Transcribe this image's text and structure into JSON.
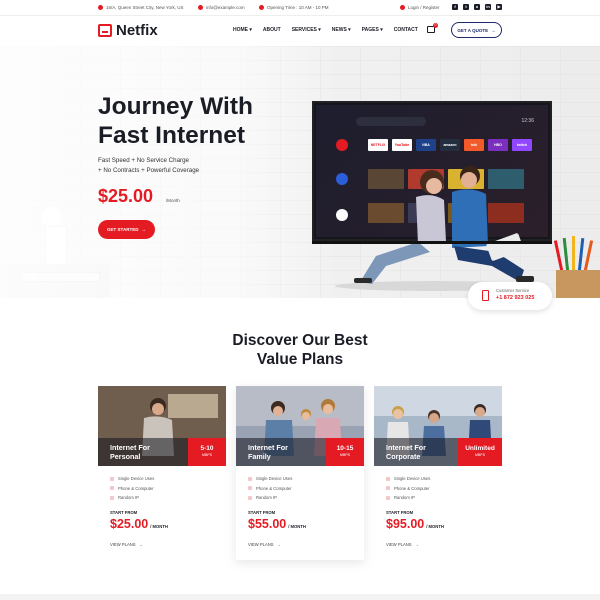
{
  "topbar": {
    "address": "16/A, Queen Street City, New York, US",
    "email": "info@example.com",
    "hours": "Opening Time : 10 AM - 10 PM",
    "login": "Login / Register"
  },
  "nav": {
    "logo": "Netfix",
    "menu": [
      "HOME",
      "ABOUT",
      "SERVICES",
      "NEWS",
      "PAGES",
      "CONTACT"
    ],
    "cart_count": "0",
    "quote": "GET A QUOTE"
  },
  "hero": {
    "title_line1": "Journey With",
    "title_line2": "Fast Internet",
    "sub_line1": "Fast Speed + No Service Charge",
    "sub_line2": "+ No Contracts + Powerful Coverage",
    "price": "$25.00",
    "unit": "/Month",
    "cta": "GET STARTED",
    "tv_time": "12:36",
    "tv_apps": [
      "NETFLIX",
      "YouTube",
      "NBA",
      "amazon",
      "tubi",
      "HBO",
      "twitch"
    ]
  },
  "customer_service": {
    "label": "Customer Service",
    "phone": "+1 872 923 025"
  },
  "plans": {
    "title_line1": "Discover Our Best",
    "title_line2": "Value Plans",
    "cards": [
      {
        "name_line1": "Internet For",
        "name_line2": "Personal",
        "speed": "5-10",
        "speed_unit": "MBPS",
        "features": [
          "Single Device Uses",
          "Phone & Computer",
          "Random IP"
        ],
        "start": "START FROM",
        "price": "$25.00",
        "per": "/ MONTH",
        "view": "VIEW PLANS"
      },
      {
        "name_line1": "Internet For",
        "name_line2": "Family",
        "speed": "10-15",
        "speed_unit": "MBPS",
        "features": [
          "Single Device Uses",
          "Phone & Computer",
          "Random IP"
        ],
        "start": "START FROM",
        "price": "$55.00",
        "per": "/ MONTH",
        "view": "VIEW PLANS"
      },
      {
        "name_line1": "Internet For",
        "name_line2": "Corporate",
        "speed": "Unlimited",
        "speed_unit": "MBPS",
        "features": [
          "Single Device Uses",
          "Phone & Computer",
          "Random IP"
        ],
        "start": "START FROM",
        "price": "$95.00",
        "per": "/ MONTH",
        "view": "VIEW PLANS"
      }
    ]
  },
  "colors": {
    "accent": "#e41b23",
    "navy": "#1e2a6b",
    "text": "#1b1d26"
  }
}
